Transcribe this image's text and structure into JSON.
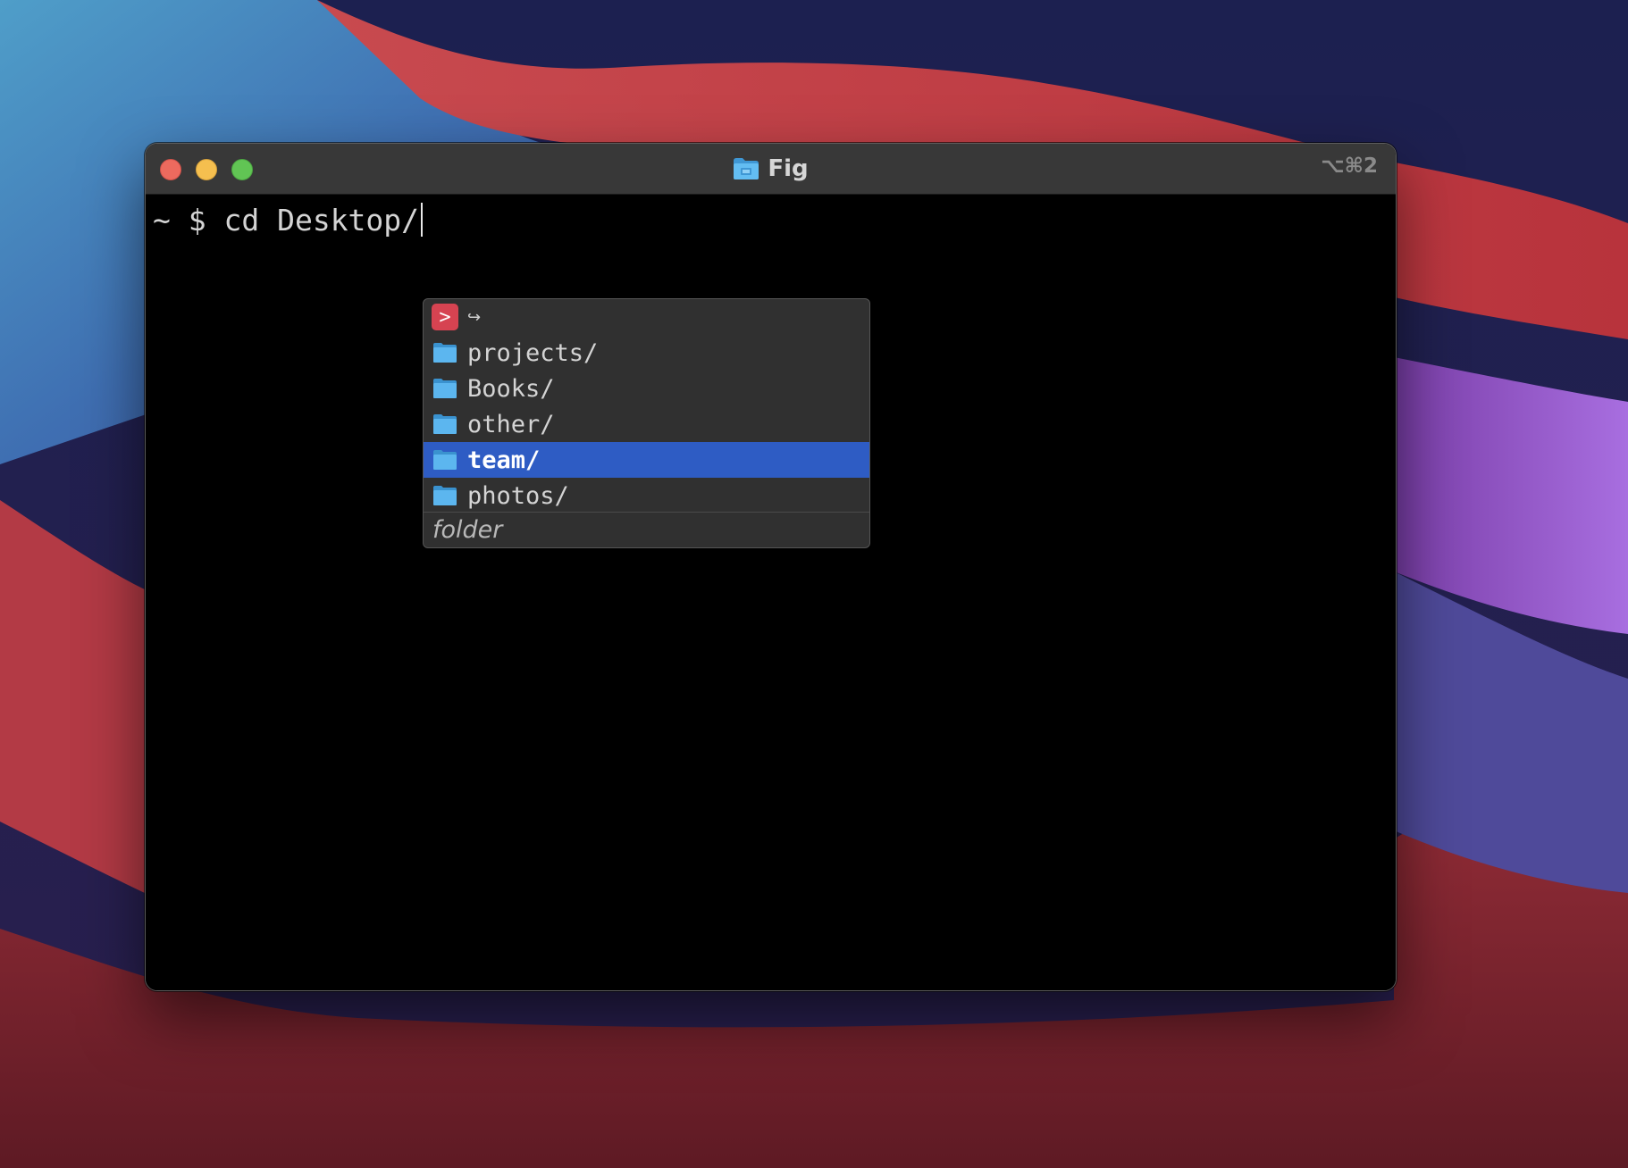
{
  "window": {
    "title": "Fig",
    "title_icon": "folder-icon",
    "shortcut": "⌥⌘2"
  },
  "terminal": {
    "prompt": "~ $ ",
    "command": "cd Desktop/"
  },
  "autocomplete": {
    "header_badge": ">",
    "header_glyph": "↪",
    "items": [
      {
        "label": "projects/",
        "icon": "folder-icon",
        "selected": false
      },
      {
        "label": "Books/",
        "icon": "folder-icon",
        "selected": false
      },
      {
        "label": "other/",
        "icon": "folder-icon",
        "selected": false
      },
      {
        "label": "team/",
        "icon": "folder-icon",
        "selected": true
      },
      {
        "label": "photos/",
        "icon": "folder-icon",
        "selected": false
      }
    ],
    "description": "folder"
  },
  "colors": {
    "selection": "#2e5cc4",
    "fig_badge": "#d64351",
    "folder_blue": "#5cb6ef"
  }
}
